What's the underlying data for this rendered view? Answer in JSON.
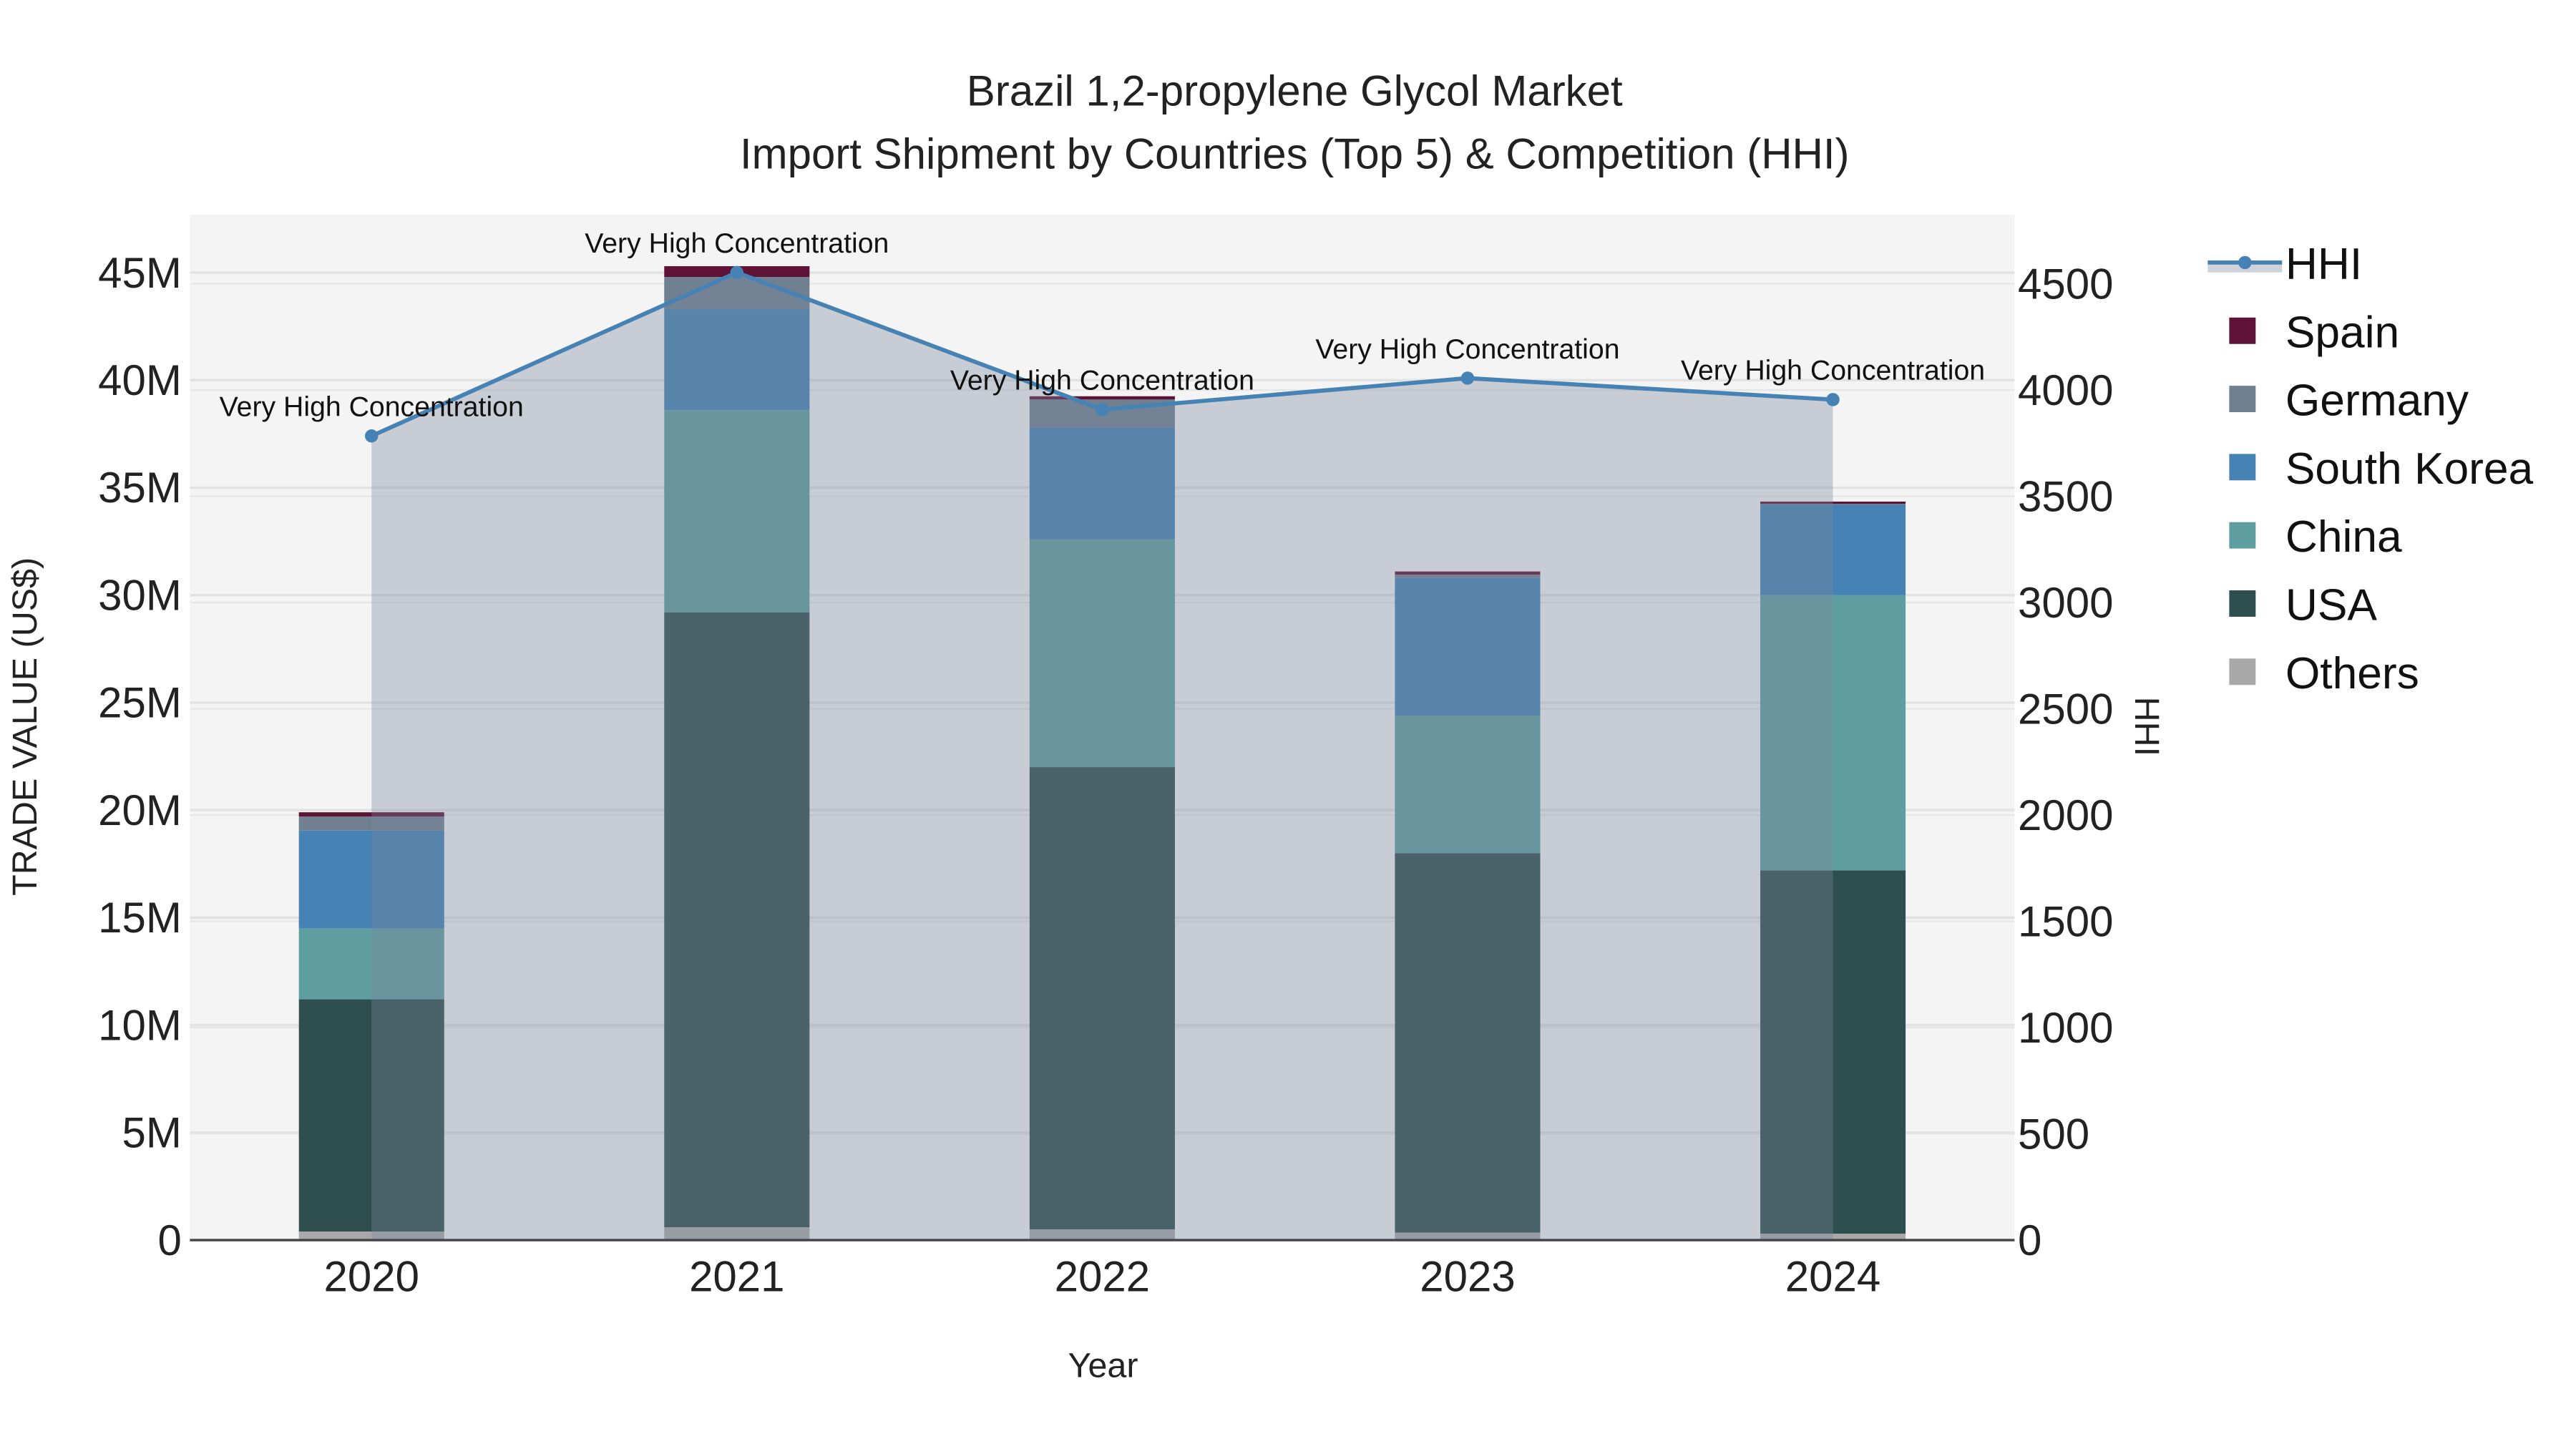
{
  "chart_data": {
    "type": "bar",
    "stacked": true,
    "title": "Brazil 1,2-propylene Glycol Market",
    "subtitle": "Import Shipment by Countries (Top 5) & Competition (HHI)",
    "xlabel": "Year",
    "ylabel": "TRADE VALUE (US$)",
    "y2label": "HHI",
    "categories": [
      "2020",
      "2021",
      "2022",
      "2023",
      "2024"
    ],
    "ylim": [
      0,
      47.5
    ],
    "y_unit": "M",
    "y_ticks": [
      0,
      5,
      10,
      15,
      20,
      25,
      30,
      35,
      40,
      45
    ],
    "y_tick_labels": [
      "0",
      "5M",
      "10M",
      "15M",
      "20M",
      "25M",
      "30M",
      "35M",
      "40M",
      "45M"
    ],
    "y2lim": [
      0,
      4800
    ],
    "y2_ticks": [
      0,
      500,
      1000,
      1500,
      2000,
      2500,
      3000,
      3500,
      4000,
      4500
    ],
    "y2_tick_labels": [
      "0",
      "500",
      "1000",
      "1500",
      "2000",
      "2500",
      "3000",
      "3500",
      "4000",
      "4500"
    ],
    "series": [
      {
        "name": "Others",
        "color": "#A9A9A9",
        "values": [
          0.4,
          0.6,
          0.5,
          0.35,
          0.3
        ]
      },
      {
        "name": "USA",
        "color": "#2F4F4F",
        "values": [
          10.8,
          28.6,
          21.5,
          17.65,
          16.9
        ]
      },
      {
        "name": "China",
        "color": "#5F9EA0",
        "values": [
          3.3,
          9.4,
          10.6,
          6.4,
          12.8
        ]
      },
      {
        "name": "South Korea",
        "color": "#4682B4",
        "values": [
          4.55,
          4.7,
          5.2,
          6.4,
          4.2
        ]
      },
      {
        "name": "Germany",
        "color": "#708090",
        "values": [
          0.65,
          1.5,
          1.3,
          0.15,
          0.05
        ]
      },
      {
        "name": "Spain",
        "color": "#5E1235",
        "values": [
          0.2,
          0.5,
          0.15,
          0.15,
          0.1
        ]
      }
    ],
    "hhi": {
      "name": "HHI",
      "color": "#4682B4",
      "values": [
        3784,
        4553,
        3908,
        4056,
        3955
      ],
      "annotations": [
        "Very High Concentration",
        "Very High Concentration",
        "Very High Concentration",
        "Very High Concentration",
        "Very High Concentration"
      ]
    },
    "legend": [
      "HHI",
      "Spain",
      "Germany",
      "South Korea",
      "China",
      "USA",
      "Others"
    ],
    "legend_placement": "right",
    "grid": true
  }
}
